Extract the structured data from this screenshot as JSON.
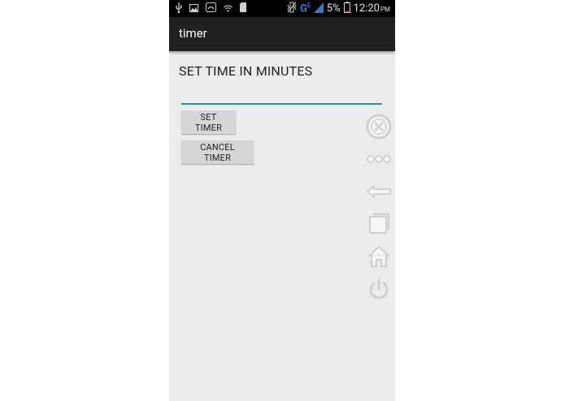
{
  "status_bar": {
    "network": "G",
    "network_sup": "E",
    "battery": "5%",
    "time": "12:20",
    "ampm": "PM",
    "icons": [
      "usb-icon",
      "image-icon",
      "sim-icon",
      "wifi-icon",
      "sd-card-icon",
      "vibrate-icon",
      "signal-icon",
      "battery-icon"
    ]
  },
  "action_bar": {
    "title": "timer"
  },
  "main": {
    "label": "SET TIME IN MINUTES",
    "input_value": "",
    "set_button": "SET TIMER",
    "cancel_button": "CANCEL TIMER"
  },
  "floating_bar": {
    "icons": [
      "close-icon",
      "more-icon",
      "back-icon",
      "recent-apps-icon",
      "home-icon",
      "power-icon"
    ]
  },
  "colors": {
    "accent": "#199c8e",
    "action_bar": "#212121",
    "background": "#ececec",
    "network": "#3a78d8"
  }
}
